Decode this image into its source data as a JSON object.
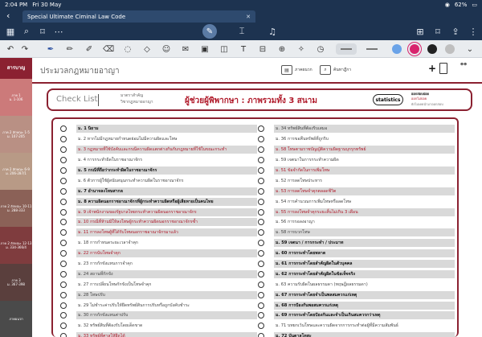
{
  "status": {
    "time": "2:04 PM",
    "date": "Fri 30 May",
    "battery": "62%"
  },
  "doc_tab": {
    "title": "Special Ultimate Ciminal Law Code"
  },
  "colors": {
    "accent": "#8b2131",
    "title_red": "#b01a2a",
    "swatches": [
      "#6aa3e8",
      "#d8246d",
      "#222222",
      "#bfbfbf"
    ]
  },
  "sidebar": {
    "tabs": [
      {
        "title": "สารบาญ",
        "sub": "",
        "color": "#8b2131",
        "h": 26
      },
      {
        "title": "ภาค 1",
        "sub": "ม. 1-106",
        "color": "#cc7a7a",
        "h": 46
      },
      {
        "title": "ภาค 2 ลักษณะ 1-5",
        "sub": "ม. 107-205",
        "color": "#b99084",
        "h": 46
      },
      {
        "title": "ภาค 2 ลักษณะ 6-9",
        "sub": "ม. 206-287/1",
        "color": "#b89a86",
        "h": 46
      },
      {
        "title": "ภาค 2 ลักษณะ 10-11",
        "sub": "ม. 288-333",
        "color": "#8b6157",
        "h": 46
      },
      {
        "title": "ภาค 2 ลักษณะ 12-13",
        "sub": "ม. 334-366/4",
        "color": "#7f3c3e",
        "h": 46
      },
      {
        "title": "ภาค 3",
        "sub": "ม. 367-398",
        "color": "#5a3f3d",
        "h": 46
      },
      {
        "title": "ภาคผนวก",
        "sub": "",
        "color": "#4a4a4a",
        "h": 45
      }
    ]
  },
  "header": {
    "title": "ประมวลกฎหมายอาญา",
    "appendix_label": "ภาคผนวก",
    "search_label": "ค้นหาฎีกา"
  },
  "checklist": {
    "title": "Check List",
    "sub1": "มาตราสำคัญ",
    "sub2": "วิชากฎหมายอาญา",
    "main_title": "ผู้ช่วยผู้พิพากษา : ภาพรวมทั้ง 3 สนาม",
    "statistics_label": "statistics",
    "legend1": "ออกสอบบ่อย",
    "legend2": "ออกไม่บ่อย",
    "legend3": "ยังไม่เคยนำมาออกสอบ"
  },
  "list_left": [
    {
      "label": "ม. 1 นิยาม",
      "style": "bold"
    },
    {
      "label": "ม. 2 หากไม่มีกฎหมายกำหนดย่อมไม่มีความผิดและโทษ",
      "style": "plain"
    },
    {
      "label": "ม. 3 กฎหมายที่ใช้บังคับและกรณีความผิดแตกต่างกันกับกฎหมายที่ใช้ในขณะกระทำ",
      "style": "red"
    },
    {
      "label": "ม. 4 การกระทำผิดในราชอาณาจักร",
      "style": "plain"
    },
    {
      "label": "ม. 5 กรณีที่ถือว่ากระทำผิดในราชอาณาจักร",
      "style": "bold"
    },
    {
      "label": "ม. 6 ตัวการผู้ใช้ผู้สนับสนุนกระทำความผิดในราชอาณาจักร",
      "style": "plain"
    },
    {
      "label": "ม. 7 อำนาจลงโทษสากล",
      "style": "bold"
    },
    {
      "label": "ม. 8 ความผิดนอกราชอาณาจักรที่ผู้กระทำความผิดหรือผู้เสียหายเป็นคนไทย",
      "style": "bold"
    },
    {
      "label": "ม. 9 เจ้าพนักงานของรัฐบาลไทยกระทำความผิดนอกราชอาณาจักร",
      "style": "red"
    },
    {
      "label": "ม. 10 กรณีที่ห้ามมิให้ลงโทษผู้กระทำความผิดนอกราชอาณาจักรซ้ำ",
      "style": "red"
    },
    {
      "label": "ม. 11 การลงโทษผู้ที่ได้รับโทษนอกราชอาณาจักรมาแล้ว",
      "style": "red"
    },
    {
      "label": "ม. 18 การกำหนดระยะเวลาจำคุก",
      "style": "plain"
    },
    {
      "label": "ม. 22 การนับโทษจำคุก",
      "style": "red"
    },
    {
      "label": "ม. 23 การกักขังแทนการจำคุก",
      "style": "plain"
    },
    {
      "label": "ม. 24 สถานที่กักขัง",
      "style": "plain"
    },
    {
      "label": "ม. 27 การเปลี่ยนโทษกักขังเป็นโทษจำคุก",
      "style": "plain"
    },
    {
      "label": "ม. 28 โทษปรับ",
      "style": "plain"
    },
    {
      "label": "ม. 29 ไม่ชำระค่าปรับให้ยึดทรัพย์สินการปรับหรือถูกบังคับชำระ",
      "style": "plain"
    },
    {
      "label": "ม. 30 การกักขังแทนค่าปรับ",
      "style": "plain"
    },
    {
      "label": "ม. 32 ทรัพย์สินที่ต้องรับโดยเด็ดขาด",
      "style": "plain"
    },
    {
      "label": "ม. 33 ทรัพย์ที่ศาลให้ยึดได้",
      "style": "red"
    }
  ],
  "list_right": [
    {
      "label": "ม. 34 ทรัพย์สินที่ต้องริบเสมอ",
      "style": "plain"
    },
    {
      "label": "ม. 36 การขอคืนทรัพย์ที่ถูกริบ",
      "style": "plain"
    },
    {
      "label": "ม. 58 โทษตามราชบัญญัติความผิดฐานบุกรุกทรัพย์",
      "style": "red"
    },
    {
      "label": "ม. 59 เจตนาในการกระทำความผิด",
      "style": "plain"
    },
    {
      "label": "ม. 51 ข้อจำกัดในการเพิ่มโทษ",
      "style": "red"
    },
    {
      "label": "ม. 52 การลดโทษประหาร",
      "style": "plain"
    },
    {
      "label": "ม. 53 การลดโทษจำคุกตลอดชีวิต",
      "style": "red"
    },
    {
      "label": "ม. 54 การคำนวณการเพิ่มโทษหรือลดโทษ",
      "style": "plain"
    },
    {
      "label": "ม. 55 การลงโทษจำคุกระยะสั้นไม่เกิน 3 เดือน",
      "style": "red"
    },
    {
      "label": "ม. 56 การรอลงอาญา",
      "style": "plain"
    },
    {
      "label": "ม. 58 การบวกโทษ",
      "style": "plain"
    },
    {
      "label": "ม. 59 เจตนา / การกระทำ / ประมาท",
      "style": "bold"
    },
    {
      "label": "ม. 60 การกระทำโดยพลาด",
      "style": "bold"
    },
    {
      "label": "ม. 61 การกระทำโดยสำคัญผิดในตัวบุคคล",
      "style": "bold"
    },
    {
      "label": "ม. 62 การกระทำโดยสำคัญผิดในข้อเท็จจริง",
      "style": "bold"
    },
    {
      "label": "ม. 63 ความรับผิดในผลธรรมดา (ทฤษฎีผลธรรมดา)",
      "style": "plain"
    },
    {
      "label": "ม. 67 การกระทำโดยจำเป็นพลสมควรแก่เหตุ",
      "style": "bold"
    },
    {
      "label": "ม. 68 การป้องกันพอสมควรแก่เหตุ",
      "style": "bold"
    },
    {
      "label": "ม. 69 การกระทำโดยป้องกันและจำเป็นเกินสมควรกว่าเหตุ",
      "style": "bold"
    },
    {
      "label": "ม. 71 บทยกเว้นโทษและความผิดจากการกระทำต่อผู้ที่มีความสัมพันธ์",
      "style": "plain"
    },
    {
      "label": "ม. 72 บันดาลโทสะ",
      "style": "bold"
    }
  ]
}
